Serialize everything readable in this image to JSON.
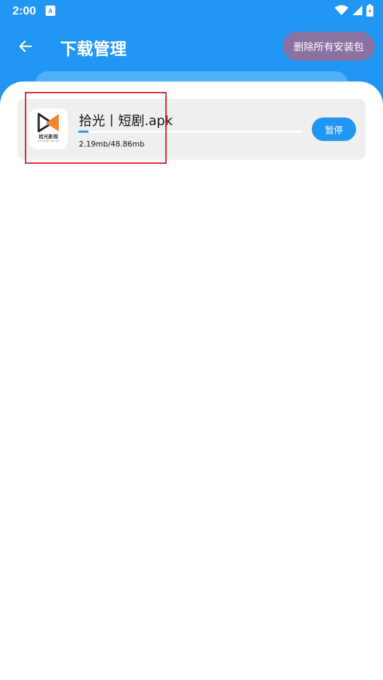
{
  "status_bar": {
    "time": "2:00",
    "notification_icon": "text-a-icon",
    "icons": [
      "wifi-icon",
      "cellular-signal-icon",
      "battery-charging-icon"
    ]
  },
  "header": {
    "back_icon": "arrow-left-icon",
    "title": "下载管理",
    "delete_all_label": "删除所有安装包"
  },
  "downloads": [
    {
      "app_icon": "shiguang-app-logo-icon",
      "icon_caption": "拾光影视",
      "icon_subcaption": "SHI GUANG YING SHI",
      "file_name": "拾光丨短剧.apk",
      "progress": 0.045,
      "size_text": "2.19mb/48.86mb",
      "action_label": "暂停"
    }
  ],
  "colors": {
    "primary": "#2196F3",
    "delete_button": "#8A72A3",
    "item_background": "#EFEFEF",
    "highlight": "#E0232E",
    "logo_orange": "#F0852D"
  }
}
